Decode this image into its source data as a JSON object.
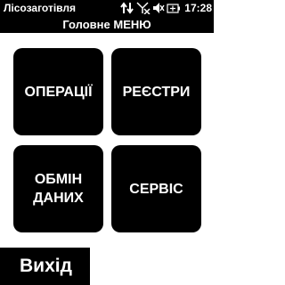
{
  "statusbar": {
    "app_title": "Лісозаготівля",
    "time": "17:28",
    "icons": [
      "data-transfer-icon",
      "no-signal-icon",
      "speaker-muted-icon",
      "battery-icon"
    ]
  },
  "menu": {
    "title": "Головне МЕНЮ",
    "buttons": {
      "operations": "ОПЕРАЦІЇ",
      "registers": "РЕЄСТРИ",
      "exchange": "ОБМІН ДАНИХ",
      "service": "СЕРВІС"
    }
  },
  "exit": {
    "label": "Вихід"
  },
  "colors": {
    "background": "#ffffff",
    "button": "#000000",
    "text": "#ffffff"
  }
}
